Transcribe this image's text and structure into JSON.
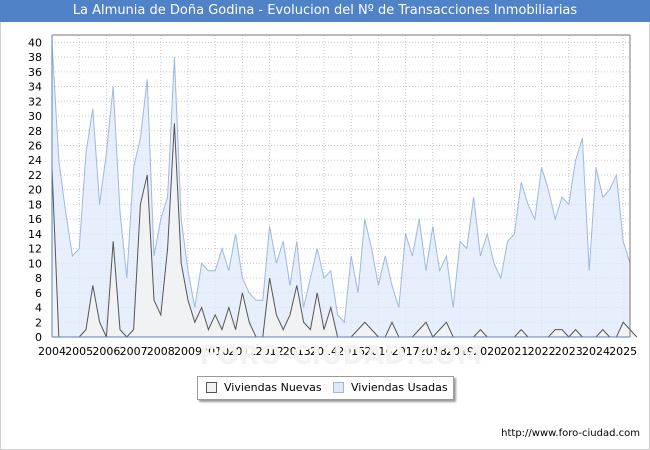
{
  "title": "La Almunia de Doña Godina - Evolucion del Nº de Transacciones Inmobiliarias",
  "source": "http://www.foro-ciudad.com",
  "watermark": "FORO-CIUDAD.COM",
  "colors": {
    "title_bg": "#4f82c7",
    "usadas_fill": "#deeaf9",
    "usadas_line": "#9db9e0",
    "nuevas_fill": "#f2f2f2",
    "nuevas_line": "#555555",
    "grid": "#c9c9c9"
  },
  "chart_data": {
    "type": "area",
    "title": "La Almunia de Doña Godina - Evolucion del Nº de Transacciones Inmobiliarias",
    "x_ticks": [
      "2004",
      "2005",
      "2006",
      "2007",
      "2008",
      "2009",
      "2010",
      "2011",
      "2012",
      "2013",
      "2014",
      "2015",
      "2016",
      "2017",
      "2018",
      "2019",
      "2020",
      "2021",
      "2022",
      "2023",
      "2024",
      "2025"
    ],
    "y_ticks": [
      0,
      2,
      4,
      6,
      8,
      10,
      12,
      14,
      16,
      18,
      20,
      22,
      24,
      26,
      28,
      30,
      32,
      34,
      36,
      38,
      40
    ],
    "ylim": [
      0,
      41
    ],
    "xlim": [
      2004,
      2025.25
    ],
    "x_start": 2004,
    "x_step": 0.25,
    "grid": true,
    "legend_position": "bottom",
    "series": [
      {
        "name": "Viviendas Nuevas",
        "values": [
          23,
          0,
          0,
          0,
          0,
          1,
          7,
          2,
          0,
          13,
          1,
          0,
          1,
          18,
          22,
          5,
          3,
          12,
          29,
          10,
          5,
          2,
          4,
          1,
          3,
          1,
          4,
          1,
          6,
          2,
          0,
          0,
          8,
          3,
          1,
          3,
          7,
          2,
          1,
          6,
          1,
          4,
          0,
          0,
          0,
          1,
          2,
          1,
          0,
          0,
          2,
          0,
          0,
          0,
          1,
          2,
          0,
          1,
          2,
          0,
          0,
          0,
          0,
          1,
          0,
          0,
          0,
          0,
          0,
          1,
          0,
          0,
          0,
          0,
          1,
          1,
          0,
          1,
          0,
          0,
          0,
          1,
          0,
          0,
          2,
          1,
          0
        ]
      },
      {
        "name": "Viviendas Usadas",
        "values": [
          40,
          24,
          17,
          11,
          12,
          25,
          31,
          18,
          25,
          34,
          17,
          8,
          23,
          27,
          35,
          11,
          16,
          19,
          38,
          16,
          9,
          4,
          10,
          9,
          9,
          12,
          9,
          14,
          8,
          6,
          5,
          5,
          15,
          10,
          13,
          7,
          13,
          4,
          8,
          12,
          8,
          9,
          3,
          2,
          11,
          6,
          16,
          12,
          7,
          11,
          7,
          4,
          14,
          11,
          16,
          9,
          15,
          9,
          11,
          4,
          13,
          12,
          19,
          11,
          14,
          10,
          8,
          13,
          14,
          21,
          18,
          16,
          23,
          20,
          16,
          19,
          18,
          24,
          27,
          9,
          23,
          19,
          20,
          22,
          13,
          10
        ]
      }
    ]
  }
}
